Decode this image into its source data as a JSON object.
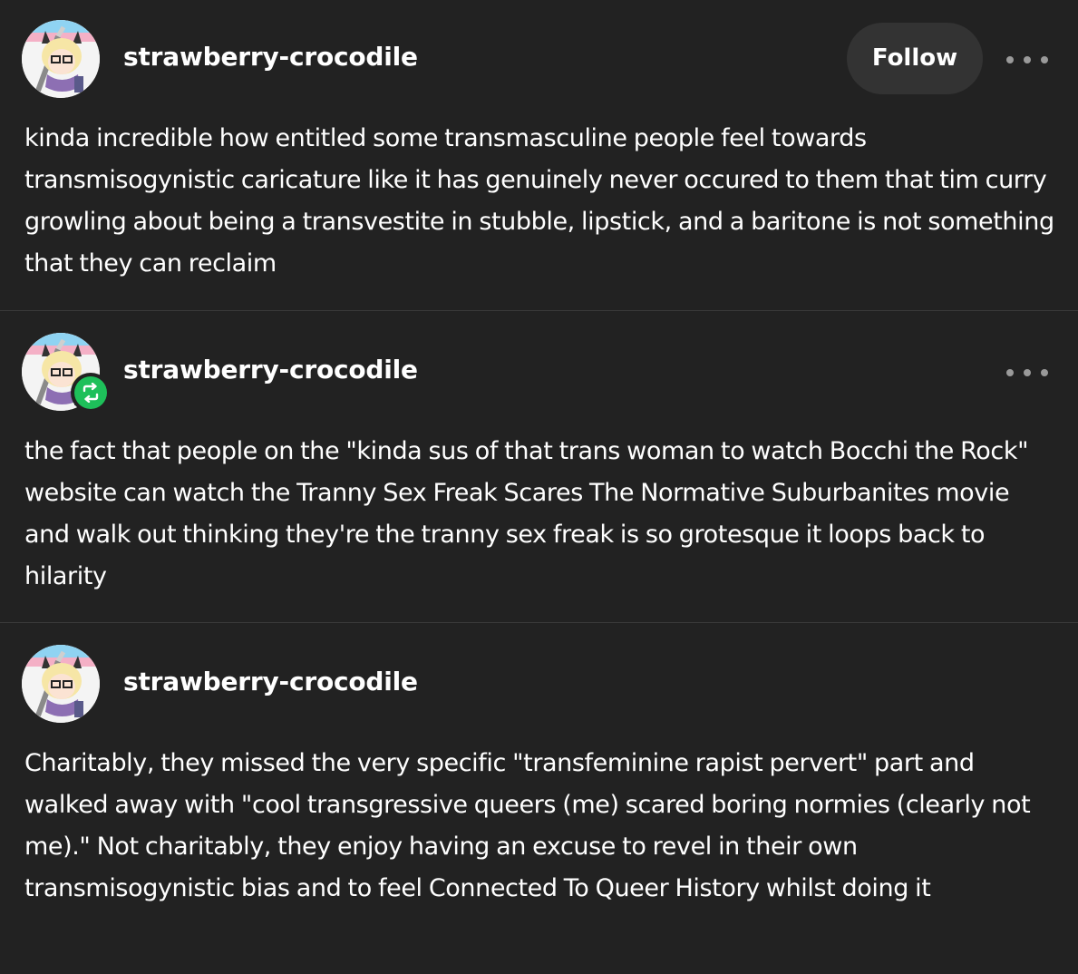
{
  "posts": [
    {
      "username": "strawberry-crocodile",
      "follow_label": "Follow",
      "text": "kinda incredible how entitled some transmasculine people feel towards transmisogynistic caricature like it has genuinely never occured to them that tim curry growling about being a transvestite in stubble, lipstick, and a baritone is not something that they can reclaim"
    },
    {
      "username": "strawberry-crocodile",
      "text": "the fact that people on the \"kinda sus of that trans woman to watch Bocchi the Rock\" website can watch the Tranny Sex Freak Scares The Normative Suburbanites movie and walk out thinking they're the tranny sex freak is so grotesque it loops back to hilarity"
    },
    {
      "username": "strawberry-crocodile",
      "text": "Charitably, they missed the very specific \"transfeminine rapist pervert\" part and walked away with \"cool transgressive queers (me) scared boring normies (clearly not me).\" Not charitably, they enjoy having an excuse to revel in their own transmisogynistic bias and to feel Connected To Queer History whilst doing it"
    }
  ],
  "colors": {
    "background": "#222222",
    "divider": "#3a3a3a",
    "follow_button": "#333333",
    "reblog_badge": "#1ec05a",
    "text": "#ffffff",
    "muted": "#9a9a9a"
  },
  "icons": {
    "more": "ellipsis-icon",
    "reblog": "reblog-icon"
  }
}
